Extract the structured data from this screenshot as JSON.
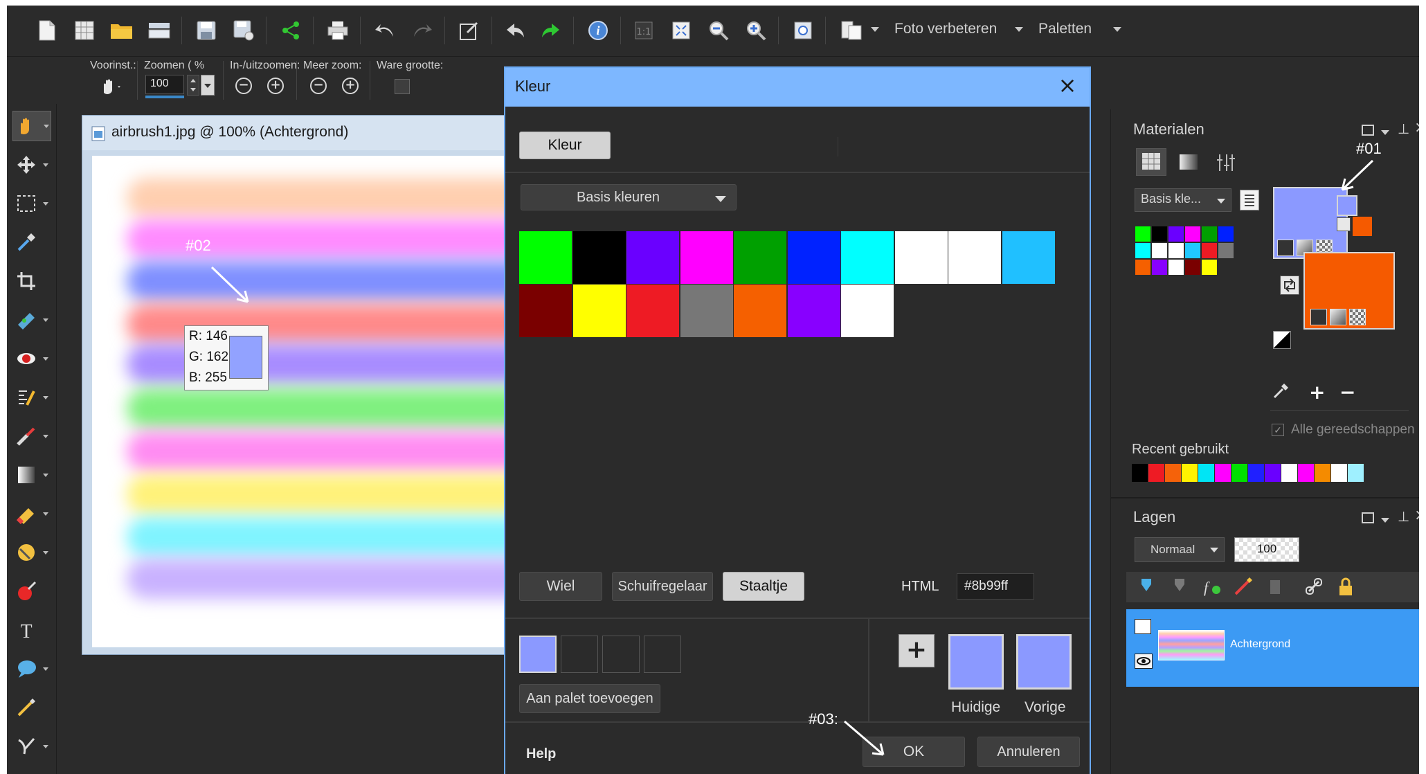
{
  "toolbar": {
    "menus": [
      {
        "label": "Foto verbeteren"
      },
      {
        "label": "Paletten"
      }
    ]
  },
  "options_bar": {
    "presets_label": "Voorinst.:",
    "zoom_label": "Zoomen ( %",
    "zoom_value": "100",
    "inout_label": "In-/uitzoomen:",
    "more_zoom_label": "Meer zoom:",
    "actual_size_label": "Ware grootte:"
  },
  "image_window": {
    "title": "airbrush1.jpg @ 100% (Achtergrond)"
  },
  "color_picker_readout": {
    "r": "R: 146",
    "g": "G: 162",
    "b": "B: 255",
    "swatch_color": "#92a2ff"
  },
  "annotations": {
    "a1": "#01",
    "a2": "#02",
    "a3": "#03:"
  },
  "materials": {
    "title": "Materialen",
    "palette_dropdown": "Basis kle...",
    "foreground_color": "#8b99ff",
    "background_color": "#f55a00",
    "all_tools_label": "Alle gereedschappen",
    "recent_title": "Recent gebruikt",
    "recent_colors": [
      "#000000",
      "#ee1b24",
      "#f5620a",
      "#fff200",
      "#00e5f5",
      "#ff00ff",
      "#00e000",
      "#2020ff",
      "#6a00ff",
      "#ffffff",
      "#ff00ff",
      "#f58b00",
      "#ffffff",
      "#9ff0ff"
    ],
    "palette_colors": [
      "#00ff00",
      "#000000",
      "#6a00ff",
      "#ff00ff",
      "#00a000",
      "#0020ff",
      "#00ffff",
      "#ffffff",
      "#ffffff",
      "#20c8ff",
      "#ee1b24",
      "#777777",
      "#f56000",
      "#8800ff",
      "#ffffff",
      "#7a0000",
      "#ffff00"
    ]
  },
  "layers": {
    "title": "Lagen",
    "blend_mode": "Normaal",
    "opacity": "100",
    "layer_name": "Achtergrond"
  },
  "dialog": {
    "title": "Kleur",
    "tab_label": "Kleur",
    "palette_select": "Basis kleuren",
    "swatches": [
      "#00ff00",
      "#000000",
      "#6a00ff",
      "#ff00ff",
      "#00a000",
      "#0022ff",
      "#00ffff",
      "#ffffff",
      "#ffffff",
      "#20c0ff",
      "#7a0000",
      "#ffff00",
      "#ee1b24",
      "#777777",
      "#f56000",
      "#8800ff",
      "#ffffff"
    ],
    "mode_tabs": [
      "Wiel",
      "Schuifregelaar",
      "Staaltje"
    ],
    "html_label": "HTML",
    "html_value": "#8b99ff",
    "custom_slot_color": "#8b99ff",
    "add_to_palette": "Aan palet toevoegen",
    "current_label": "Huidige",
    "previous_label": "Vorige",
    "current_color": "#8b99ff",
    "previous_color": "#8b99ff",
    "help_label": "Help",
    "ok_label": "OK",
    "cancel_label": "Annuleren"
  }
}
